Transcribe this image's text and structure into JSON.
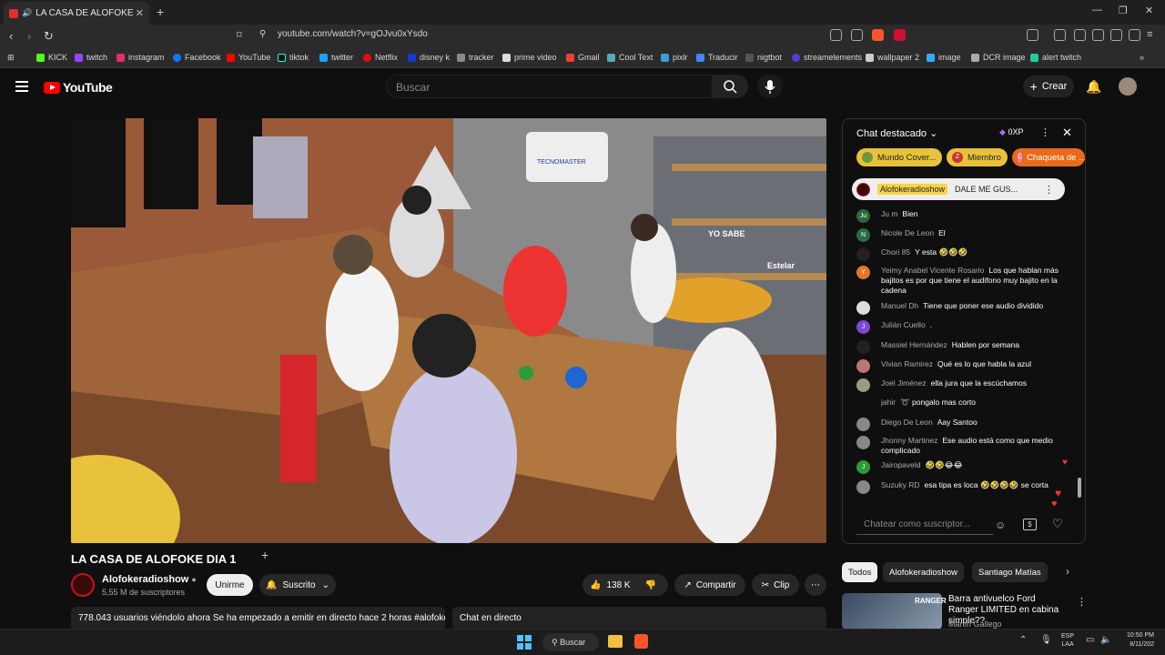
{
  "browser": {
    "tab_title": "LA CASA DE ALOFOKE DIA 1",
    "url": "youtube.com/watch?v=gOJvu0xYsdo",
    "bookmarks": [
      "KICK",
      "twitch",
      "instagram",
      "Facebook",
      "YouTube",
      "tiktok",
      "twitter",
      "Netflix",
      "disney k",
      "tracker",
      "prime video",
      "Gmail",
      "Cool Text",
      "pixlr",
      "Traducir",
      "nigtbot",
      "streamelements",
      "wallpaper 2",
      "image",
      "DCR image",
      "alert twitch"
    ]
  },
  "youtube": {
    "logo": "YouTube",
    "search_placeholder": "Buscar",
    "create_label": "Crear"
  },
  "video": {
    "title": "LA CASA DE ALOFOKE DIA 1",
    "channel": "Alofokeradioshow",
    "subscribers": "5,55 M de suscriptores",
    "join_label": "Unirme",
    "subscribed_label": "Suscrito",
    "likes": "138 K",
    "share_label": "Compartir",
    "clip_label": "Clip",
    "overlay_text": "TECNOMASTER",
    "sign_1": "YO SABE",
    "sign_2": "Estelar",
    "description": "778.043 usuarios viéndolo ahora  Se ha empezado a emitir en directo hace 2 horas  #alofoke",
    "live_chat_label": "Chat en directo"
  },
  "chat": {
    "header": "Chat destacado",
    "points": "0XP",
    "chips": [
      "Mundo Cover...",
      "Miembro",
      "Chaqueta de ..."
    ],
    "chip_letters": [
      "",
      "Z",
      "C"
    ],
    "pinned_author": "Alofokeradioshow",
    "pinned_text": "DALE ME GUS...",
    "messages": [
      {
        "letter": "Ju",
        "author": "Ju m",
        "text": "Bien"
      },
      {
        "letter": "N",
        "author": "Nicole De Leon",
        "text": "El"
      },
      {
        "letter": "",
        "author": "Chori 85",
        "text": "Y esta 🤣🤣🤣"
      },
      {
        "letter": "Y",
        "author": "Yeimy Anabel Vicente Rosario",
        "text": "Los que hablan más bajitos es por que tiene el audifono muy bajito en la cadena"
      },
      {
        "letter": "",
        "author": "Manuel Dh",
        "text": "Tiene que poner ese audio dividido"
      },
      {
        "letter": "J",
        "author": "Julián Cuello",
        "text": "."
      },
      {
        "letter": "",
        "author": "Massiel Hernández",
        "text": "Hablen por semana"
      },
      {
        "letter": "",
        "author": "Vivian Ramirez",
        "text": "Qué es lo que habla la azul"
      },
      {
        "letter": "",
        "author": "Joel Jiménez",
        "text": "ella jura que la escúchamos"
      },
      {
        "letter": "",
        "author": "jahir",
        "text": "➰ pongalo mas corto"
      },
      {
        "letter": "",
        "author": "Diego De Leon",
        "text": "Aay Santoo"
      },
      {
        "letter": "",
        "author": "Jhonny Martinez",
        "text": "Ese audio está como que medio complicado"
      },
      {
        "letter": "J",
        "author": "Jairopaveld",
        "text": "🤣🤣😂😂"
      },
      {
        "letter": "",
        "author": "Suzuky RD",
        "text": "esa tipa es loca 🤣🤣🤣🤣 se corta"
      }
    ],
    "input_placeholder": "Chatear como suscriptor..."
  },
  "related": {
    "tabs": [
      "Todos",
      "Alofokeradioshow",
      "Santiago Matías"
    ],
    "item_title": "Barra antivuelco Ford Ranger LIMITED en cabina simple??",
    "item_channel": "Martin Gallego",
    "thumb_text": "RANGER"
  },
  "taskbar": {
    "search_label": "Buscar",
    "lang": "ESP",
    "lang2": "LAA",
    "time": "10:50 PM",
    "date": "8/11/202"
  }
}
